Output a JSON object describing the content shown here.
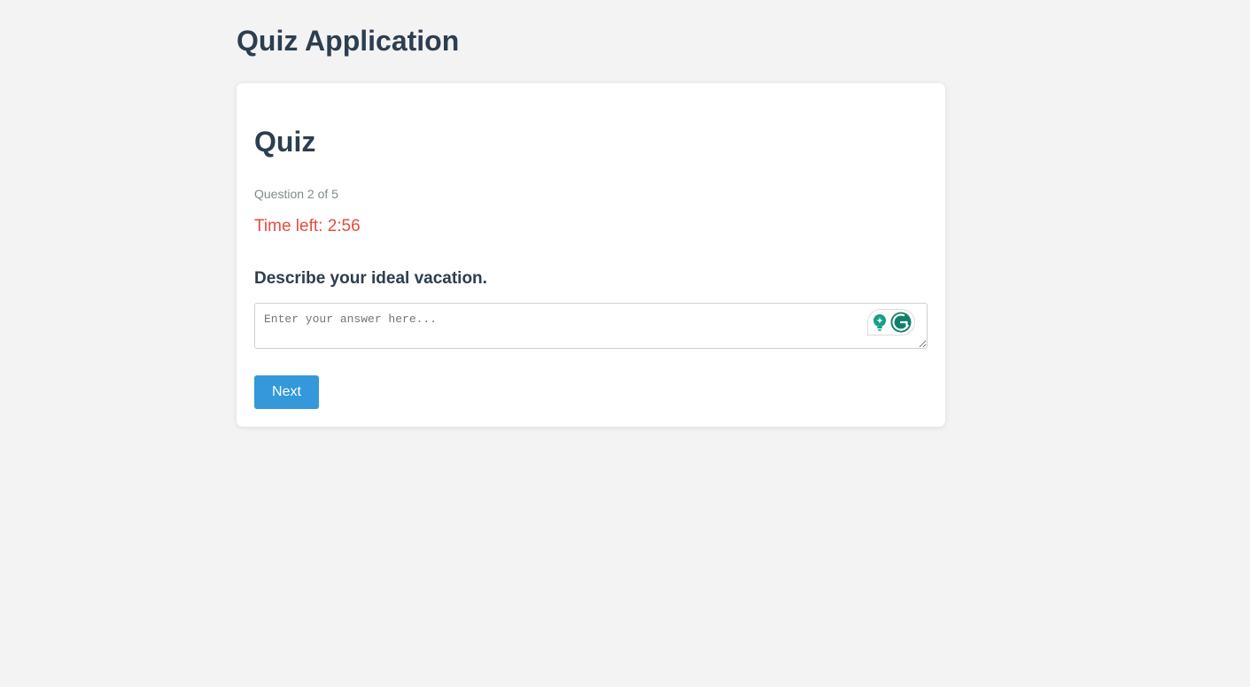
{
  "app": {
    "title": "Quiz Application"
  },
  "quiz": {
    "heading": "Quiz",
    "progress_text": "Question 2 of 5",
    "timer_text": "Time left: 2:56",
    "question": "Describe your ideal vacation.",
    "answer": {
      "value": "",
      "placeholder": "Enter your answer here..."
    },
    "next_label": "Next"
  },
  "icons": {
    "assist": "lightbulb-icon",
    "grammar": "grammarly-icon"
  },
  "colors": {
    "page_bg": "#f3f3f3",
    "heading": "#2c3e50",
    "muted": "#7f8c8d",
    "timer": "#e74c3c",
    "button": "#3498db",
    "widget_green": "#15a085"
  }
}
